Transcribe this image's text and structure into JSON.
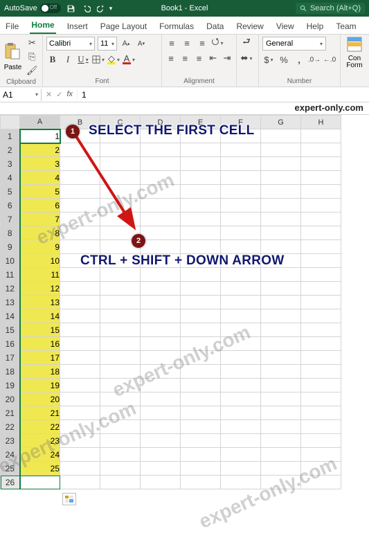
{
  "titlebar": {
    "autosave_label": "AutoSave",
    "autosave_state": "Off",
    "book_title": "Book1 - Excel",
    "search_placeholder": "Search (Alt+Q)"
  },
  "tabs": {
    "file": "File",
    "home": "Home",
    "insert": "Insert",
    "page_layout": "Page Layout",
    "formulas": "Formulas",
    "data": "Data",
    "review": "Review",
    "view": "View",
    "help": "Help",
    "team": "Team"
  },
  "ribbon": {
    "clipboard": {
      "label": "Clipboard",
      "paste": "Paste"
    },
    "font": {
      "label": "Font",
      "name": "Calibri",
      "size": "11"
    },
    "alignment": {
      "label": "Alignment"
    },
    "number": {
      "label": "Number",
      "format": "General"
    },
    "conditional": {
      "label1": "Con",
      "label2": "Form"
    }
  },
  "namebox": {
    "ref": "A1"
  },
  "formula": {
    "value": "1"
  },
  "watermark_top": "expert-only.com",
  "columns": [
    "A",
    "B",
    "C",
    "D",
    "E",
    "F",
    "G",
    "H"
  ],
  "rows": [
    {
      "n": 1,
      "v": "1"
    },
    {
      "n": 2,
      "v": "2"
    },
    {
      "n": 3,
      "v": "3"
    },
    {
      "n": 4,
      "v": "4"
    },
    {
      "n": 5,
      "v": "5"
    },
    {
      "n": 6,
      "v": "6"
    },
    {
      "n": 7,
      "v": "7"
    },
    {
      "n": 8,
      "v": "8"
    },
    {
      "n": 9,
      "v": "9"
    },
    {
      "n": 10,
      "v": "10"
    },
    {
      "n": 11,
      "v": "11"
    },
    {
      "n": 12,
      "v": "12"
    },
    {
      "n": 13,
      "v": "13"
    },
    {
      "n": 14,
      "v": "14"
    },
    {
      "n": 15,
      "v": "15"
    },
    {
      "n": 16,
      "v": "16"
    },
    {
      "n": 17,
      "v": "17"
    },
    {
      "n": 18,
      "v": "18"
    },
    {
      "n": 19,
      "v": "19"
    },
    {
      "n": 20,
      "v": "20"
    },
    {
      "n": 21,
      "v": "21"
    },
    {
      "n": 22,
      "v": "22"
    },
    {
      "n": 23,
      "v": "23"
    },
    {
      "n": 24,
      "v": "24"
    },
    {
      "n": 25,
      "v": "25"
    }
  ],
  "row26": "26",
  "annotations": {
    "badge1": "1",
    "text1": "SELECT THE FIRST CELL",
    "badge2": "2",
    "text2": "CTRL + SHIFT + DOWN ARROW"
  },
  "watermarks_diag": "expert-only.com"
}
